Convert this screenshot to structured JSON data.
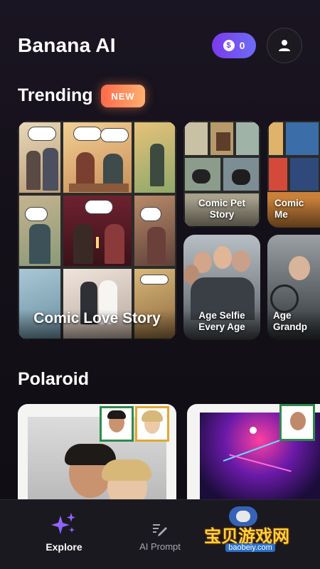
{
  "header": {
    "title": "Banana AI",
    "coin_symbol": "$",
    "coin_count": "0"
  },
  "trending": {
    "title": "Trending",
    "badge": "NEW",
    "cards": [
      {
        "label": "Comic Love Story"
      },
      {
        "label": "Comic Pet Story"
      },
      {
        "label": "Comic Me"
      },
      {
        "label": "Age Selfie Every Age"
      },
      {
        "label": "Age Grandp"
      }
    ]
  },
  "polaroid": {
    "title": "Polaroid"
  },
  "nav": {
    "items": [
      {
        "label": "Explore",
        "icon": "sparkles-icon",
        "active": true
      },
      {
        "label": "AI Prompt",
        "icon": "edit-prompt-icon",
        "active": false
      }
    ]
  },
  "watermark": {
    "text": "宝贝游戏网",
    "url": "baobeiy.com"
  },
  "colors": {
    "accent_purple": "#7c3aed",
    "badge_orange": "#ff6a4a",
    "background": "#141019"
  }
}
